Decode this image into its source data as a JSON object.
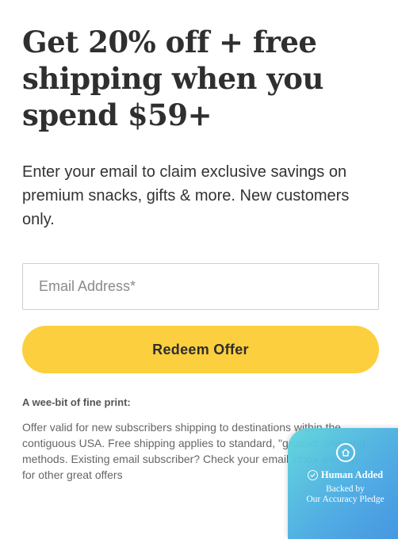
{
  "offer": {
    "headline": "Get 20% off + free shipping when you spend $59+",
    "subhead": "Enter your email to claim exclusive savings on premium snacks, gifts & more. New customers only."
  },
  "form": {
    "email_placeholder": "Email Address*",
    "submit_label": "Redeem Offer"
  },
  "fine_print": {
    "title": "A wee-bit of fine print:",
    "body": "Offer valid for new subscribers shipping to destinations within the contiguous USA. Free shipping applies to standard, \"ground\" shipping methods. Existing email subscriber? Check your email inbox weekly for other great offers"
  },
  "badge": {
    "title": "Human Added",
    "line1": "Backed by",
    "line2": "Our Accuracy Pledge",
    "icons": [
      "home-shield-icon",
      "check-circle-icon"
    ],
    "gradient": [
      "#5fd6dc",
      "#3d8fe0"
    ]
  },
  "colors": {
    "button": "#fccf3f",
    "heading": "#2f2f2f",
    "border": "#cfcfcf"
  }
}
